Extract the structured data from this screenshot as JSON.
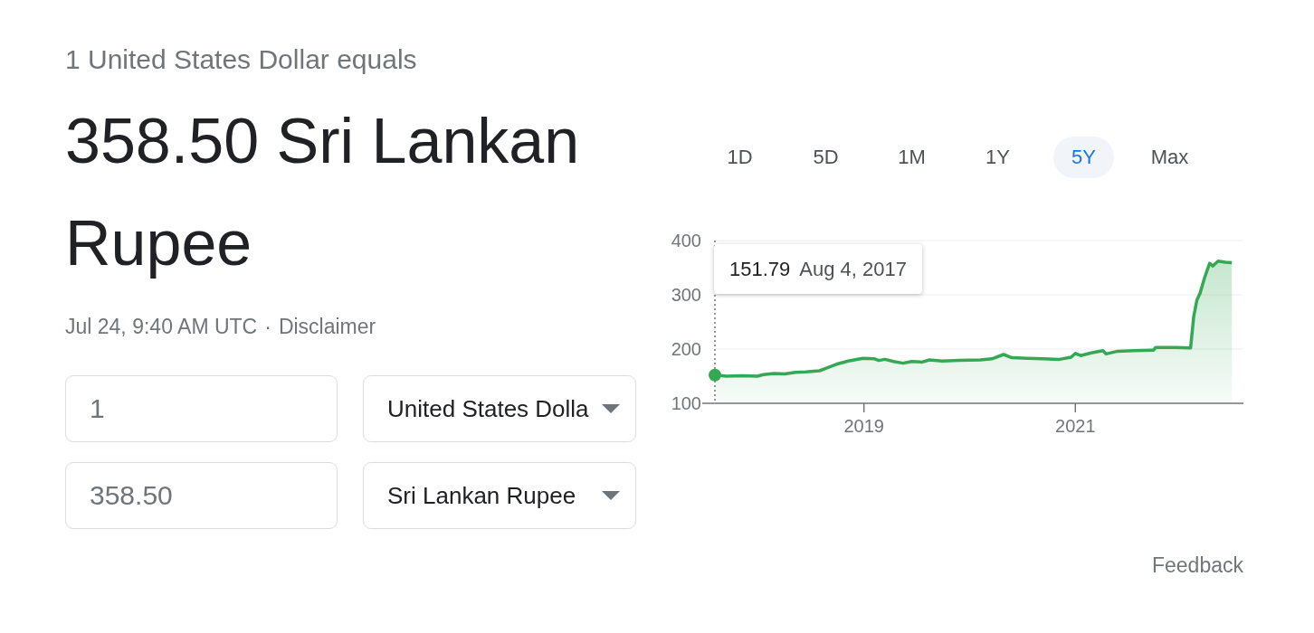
{
  "header": {
    "caption": "1 United States Dollar equals",
    "result": "358.50 Sri Lankan Rupee",
    "timestamp": "Jul 24, 9:40 AM UTC",
    "separator": "·",
    "disclaimer": "Disclaimer"
  },
  "converter": [
    {
      "amount": "1",
      "currency": "United States Dolla"
    },
    {
      "amount": "358.50",
      "currency": "Sri Lankan Rupee"
    }
  ],
  "ranges": [
    {
      "label": "1D",
      "selected": false
    },
    {
      "label": "5D",
      "selected": false
    },
    {
      "label": "1M",
      "selected": false
    },
    {
      "label": "1Y",
      "selected": false
    },
    {
      "label": "5Y",
      "selected": true
    },
    {
      "label": "Max",
      "selected": false
    }
  ],
  "chart": {
    "tooltip": {
      "value": "151.79",
      "date": "Aug 4, 2017"
    },
    "chart_data": {
      "type": "area",
      "x": [
        2017.59,
        2017.7,
        2017.85,
        2017.99,
        2018.05,
        2018.15,
        2018.25,
        2018.35,
        2018.45,
        2018.58,
        2018.66,
        2018.74,
        2018.85,
        2018.99,
        2019.1,
        2019.14,
        2019.2,
        2019.28,
        2019.37,
        2019.45,
        2019.55,
        2019.62,
        2019.74,
        2019.9,
        2020.1,
        2020.21,
        2020.32,
        2020.4,
        2020.55,
        2020.7,
        2020.85,
        2020.96,
        2021.0,
        2021.05,
        2021.15,
        2021.26,
        2021.29,
        2021.4,
        2021.55,
        2021.74,
        2021.76,
        2021.95,
        2022.09,
        2022.12,
        2022.15,
        2022.18,
        2022.22,
        2022.27,
        2022.3,
        2022.35,
        2022.42,
        2022.48
      ],
      "series": [
        {
          "color": "#34a853",
          "values": [
            152,
            150,
            151,
            150,
            153,
            155,
            154,
            157,
            158,
            160,
            166,
            172,
            178,
            183,
            182,
            179,
            181,
            177,
            174,
            177,
            176,
            180,
            178,
            179,
            180,
            182,
            190,
            184,
            183,
            182,
            181,
            185,
            192,
            188,
            193,
            197,
            191,
            196,
            197,
            198,
            203,
            203,
            202,
            260,
            290,
            303,
            330,
            358,
            353,
            362,
            360,
            359
          ]
        }
      ],
      "xlim": [
        2017.59,
        2022.59
      ],
      "ylim": [
        100,
        400
      ],
      "xticks": [
        {
          "value": 2019,
          "label": "2019"
        },
        {
          "value": 2021,
          "label": "2021"
        }
      ],
      "yticks": [
        100,
        200,
        300,
        400
      ]
    }
  },
  "feedback": "Feedback"
}
